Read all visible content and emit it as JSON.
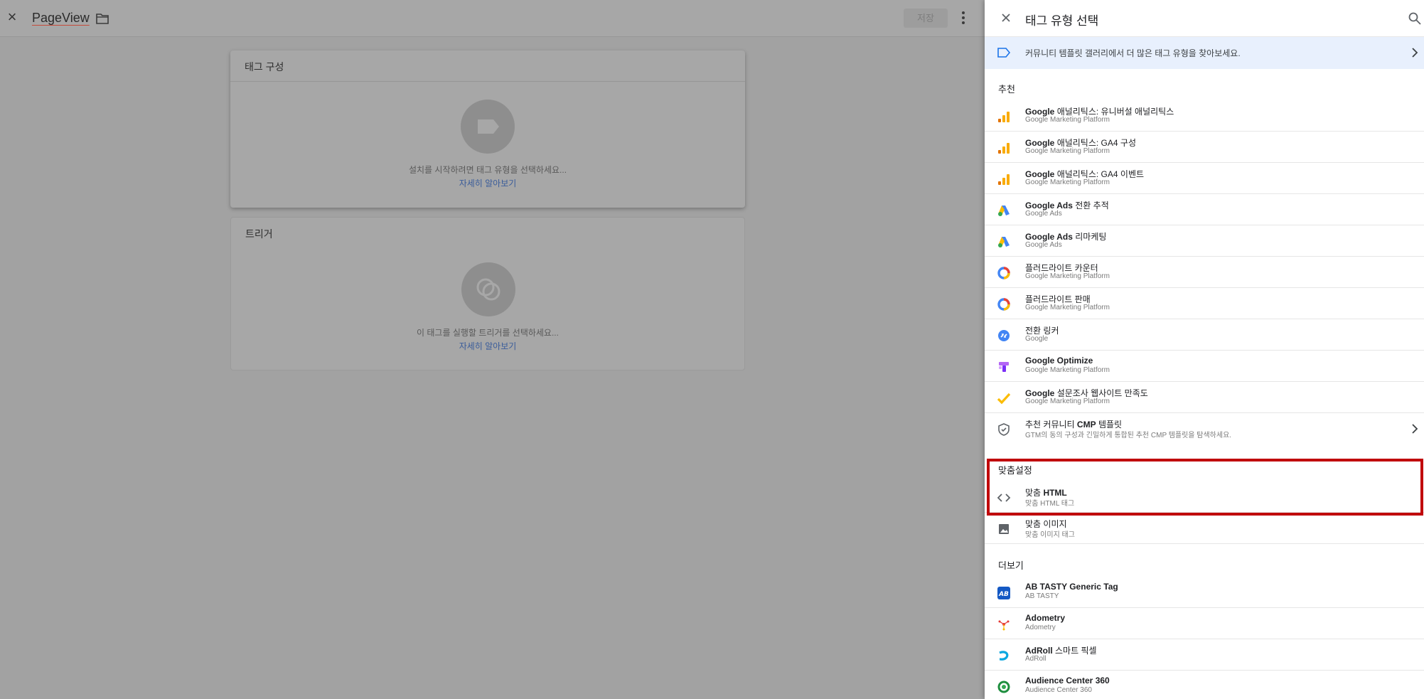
{
  "editor": {
    "tag_name": "PageView",
    "save_label": "저장",
    "tag_config": {
      "title": "태그 구성",
      "message": "설치를 시작하려면 태그 유형을 선택하세요...",
      "learn_more": "자세히 알아보기"
    },
    "trigger": {
      "title": "트리거",
      "message": "이 태그를 실행할 트리거를 선택하세요...",
      "learn_more": "자세히 알아보기"
    }
  },
  "panel": {
    "title": "태그 유형 선택",
    "gallery_text": "커뮤니티 템플릿 갤러리에서 더 많은 태그 유형을 찾아보세요.",
    "sections": {
      "recommended": "추천",
      "custom": "맞춤설정",
      "more": "더보기"
    },
    "recommended": [
      {
        "brand": "Google",
        "rest": "애널리틱스: 유니버설 애널리틱스",
        "sub": "Google Marketing Platform",
        "icon": "analytics-icon"
      },
      {
        "brand": "Google",
        "rest": "애널리틱스: GA4 구성",
        "sub": "Google Marketing Platform",
        "icon": "analytics-icon"
      },
      {
        "brand": "Google",
        "rest": "애널리틱스: GA4 이벤트",
        "sub": "Google Marketing Platform",
        "icon": "analytics-icon"
      },
      {
        "brand": "Google Ads",
        "rest": "전환 추적",
        "sub": "Google Ads",
        "icon": "google-ads-icon"
      },
      {
        "brand": "Google Ads",
        "rest": "리마케팅",
        "sub": "Google Ads",
        "icon": "google-ads-icon"
      },
      {
        "brand": "",
        "rest": "플러드라이트 카운터",
        "sub": "Google Marketing Platform",
        "icon": "floodlight-icon"
      },
      {
        "brand": "",
        "rest": "플러드라이트 판매",
        "sub": "Google Marketing Platform",
        "icon": "floodlight-icon"
      },
      {
        "brand": "",
        "rest": "전환 링커",
        "sub": "Google",
        "icon": "conversion-linker-icon"
      },
      {
        "brand": "Google Optimize",
        "rest": "",
        "sub": "Google Marketing Platform",
        "icon": "optimize-icon"
      },
      {
        "brand": "Google",
        "rest": "설문조사 웹사이트 만족도",
        "sub": "Google Marketing Platform",
        "icon": "surveys-icon"
      }
    ],
    "cmp": {
      "pre": "추천 커뮤니티",
      "bold": "CMP",
      "post": "템플릿",
      "sub": "GTM의 동의 구성과 긴밀하게 통합된 추천 CMP 템플릿을 탐색하세요."
    },
    "custom": [
      {
        "pre": "맞춤",
        "bold": "HTML",
        "sub": "맞춤 HTML 태그",
        "icon": "code-icon"
      },
      {
        "pre": "맞춤 이미지",
        "bold": "",
        "sub": "맞춤 이미지 태그",
        "icon": "image-icon"
      }
    ],
    "more": [
      {
        "brand": "AB TASTY Generic Tag",
        "rest": "",
        "sub": "AB TASTY",
        "icon": "abtasty-icon"
      },
      {
        "brand": "Adometry",
        "rest": "",
        "sub": "Adometry",
        "icon": "adometry-icon"
      },
      {
        "brand": "AdRoll",
        "rest": "스마트 픽셀",
        "sub": "AdRoll",
        "icon": "adroll-icon"
      },
      {
        "brand": "Audience Center 360",
        "rest": "",
        "sub": "Audience Center 360",
        "icon": "audience-center-icon"
      }
    ]
  },
  "colors": {
    "highlight": "#c0040b",
    "link": "#1a73e8",
    "gallery_bg": "#e8f0fd"
  }
}
